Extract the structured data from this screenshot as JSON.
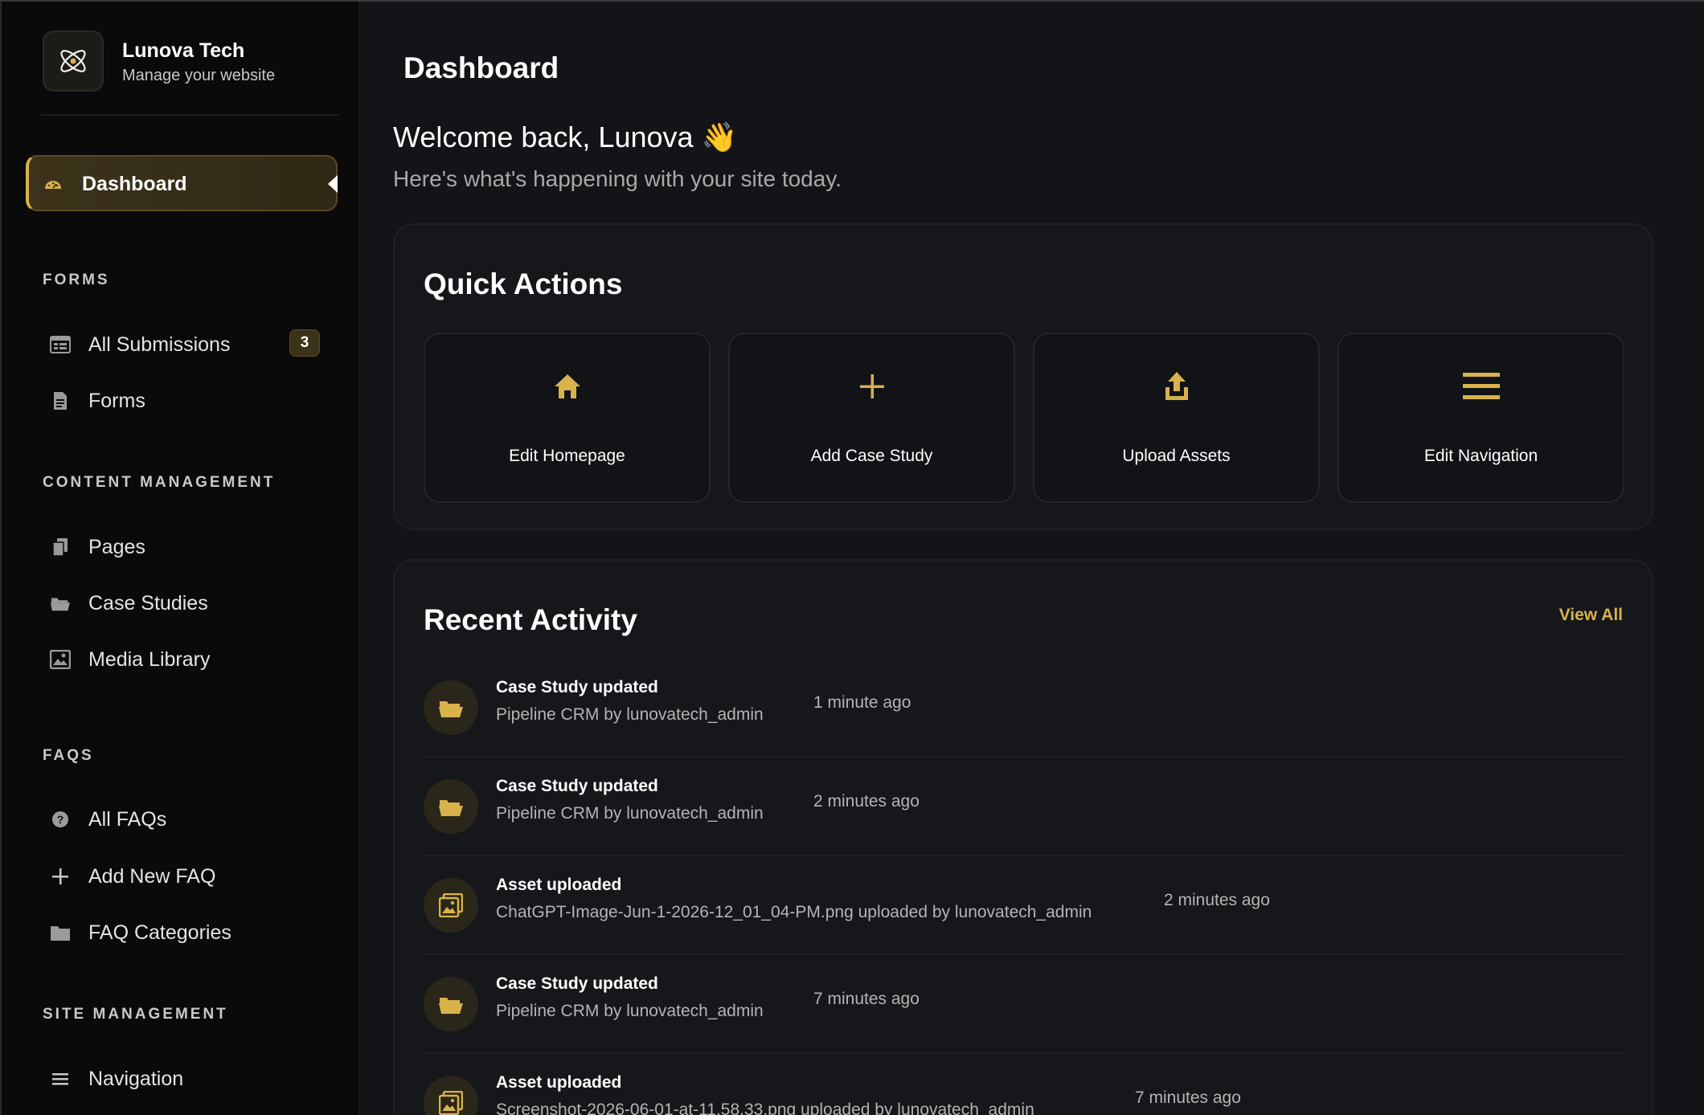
{
  "brand": {
    "name": "Lunova Tech",
    "subtitle": "Manage your website"
  },
  "sidebar": {
    "active": {
      "label": "Dashboard",
      "icon": "speedometer-icon"
    },
    "sections": [
      {
        "title": "FORMS",
        "items": [
          {
            "label": "All Submissions",
            "icon": "table-icon",
            "badge": "3"
          },
          {
            "label": "Forms",
            "icon": "document-icon"
          }
        ]
      },
      {
        "title": "CONTENT MANAGEMENT",
        "items": [
          {
            "label": "Pages",
            "icon": "pages-icon"
          },
          {
            "label": "Case Studies",
            "icon": "folder-open-icon"
          },
          {
            "label": "Media Library",
            "icon": "image-icon"
          }
        ]
      },
      {
        "title": "FAQS",
        "items": [
          {
            "label": "All FAQs",
            "icon": "question-circle-icon"
          },
          {
            "label": "Add New FAQ",
            "icon": "plus-icon"
          },
          {
            "label": "FAQ Categories",
            "icon": "folder-icon"
          }
        ]
      },
      {
        "title": "SITE MANAGEMENT",
        "items": [
          {
            "label": "Navigation",
            "icon": "menu-icon"
          }
        ]
      }
    ]
  },
  "main": {
    "page_title": "Dashboard",
    "welcome": "Welcome back, Lunova 👋",
    "welcome_sub": "Here's what's happening with your site today.",
    "quick_actions": {
      "title": "Quick Actions",
      "items": [
        {
          "label": "Edit Homepage",
          "icon": "home-icon"
        },
        {
          "label": "Add Case Study",
          "icon": "plus-icon"
        },
        {
          "label": "Upload Assets",
          "icon": "upload-icon"
        },
        {
          "label": "Edit Navigation",
          "icon": "menu-icon"
        }
      ]
    },
    "recent_activity": {
      "title": "Recent Activity",
      "view_all": "View All",
      "items": [
        {
          "title": "Case Study updated",
          "desc": "Pipeline CRM by lunovatech_admin",
          "time": "1 minute ago",
          "icon": "folder-open-icon"
        },
        {
          "title": "Case Study updated",
          "desc": "Pipeline CRM by lunovatech_admin",
          "time": "2 minutes ago",
          "icon": "folder-open-icon"
        },
        {
          "title": "Asset uploaded",
          "desc": "ChatGPT-Image-Jun-1-2026-12_01_04-PM.png uploaded by lunovatech_admin",
          "time": "2 minutes ago",
          "icon": "images-icon"
        },
        {
          "title": "Case Study updated",
          "desc": "Pipeline CRM by lunovatech_admin",
          "time": "7 minutes ago",
          "icon": "folder-open-icon"
        },
        {
          "title": "Asset uploaded",
          "desc": "Screenshot-2026-06-01-at-11.58.33.png uploaded by lunovatech_admin",
          "time": "7 minutes ago",
          "icon": "images-icon"
        }
      ]
    }
  },
  "colors": {
    "accent": "#d8b24a",
    "background": "#131418",
    "sidebar": "#0a0a0b",
    "card": "#16171b"
  }
}
